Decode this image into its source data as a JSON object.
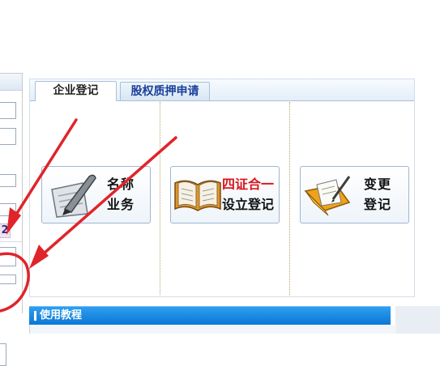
{
  "left_panel": {
    "captcha_fragment": "2"
  },
  "tabs": [
    {
      "label": "企业登记",
      "active": true
    },
    {
      "label": "股权质押申请",
      "active": false
    }
  ],
  "cards": [
    {
      "line1": "名称",
      "line2": "业务",
      "icon": "pen-paper-icon"
    },
    {
      "line1": "四证合一",
      "line2": "设立登记",
      "icon": "open-book-icon"
    },
    {
      "line1": "变更",
      "line2": "登记",
      "icon": "folder-pen-icon"
    }
  ],
  "tutorial": {
    "title": "使用教程"
  },
  "colors": {
    "annotation": "#e0242b",
    "tab_link": "#1a3f9a",
    "tutorial_bar": "#0a78d4",
    "card_highlight": "#d8161b"
  }
}
